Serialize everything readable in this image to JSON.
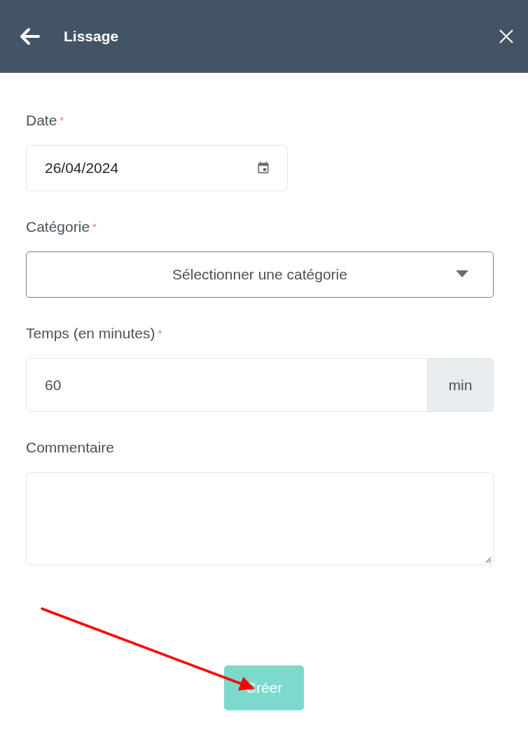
{
  "header": {
    "title": "Lissage"
  },
  "form": {
    "fields": [
      {
        "kind": "date",
        "label": "Date",
        "required_mark": "*",
        "value": "26/04/2024"
      },
      {
        "kind": "select",
        "label": "Catégorie",
        "required_mark": "*",
        "placeholder": "Sélectionner une catégorie"
      },
      {
        "kind": "addon",
        "label": "Temps (en minutes)",
        "required_mark": "*",
        "value": "60",
        "addon": "min"
      },
      {
        "kind": "textarea",
        "label": "Commentaire"
      }
    ],
    "submit": {
      "label": "Créer",
      "disabled": true
    }
  },
  "annotation": {
    "kind": "arrow"
  }
}
